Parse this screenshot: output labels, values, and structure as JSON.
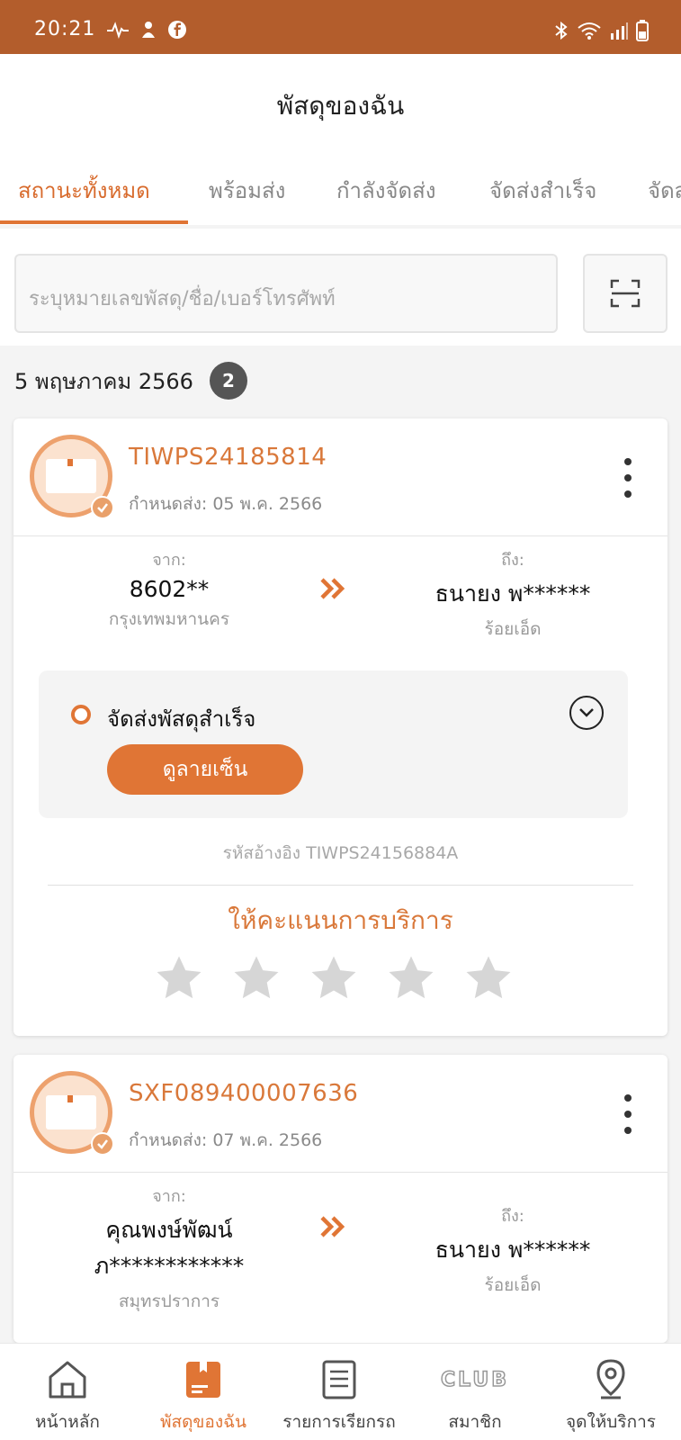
{
  "status_bar": {
    "time": "20:21",
    "left_icons": [
      "activity-icon",
      "baby-icon",
      "facebook-icon"
    ],
    "right_icons": [
      "bluetooth-icon",
      "wifi-icon",
      "signal-icon",
      "battery-icon"
    ]
  },
  "header": {
    "title": "พัสดุของฉัน"
  },
  "tabs": [
    {
      "label": "สถานะทั้งหมด",
      "active": true
    },
    {
      "label": "พร้อมส่ง"
    },
    {
      "label": "กำลังจัดส่ง"
    },
    {
      "label": "จัดส่งสำเร็จ"
    },
    {
      "label": "จัดส"
    }
  ],
  "search": {
    "placeholder": "ระบุหมายเลขพัสดุ/ชื่อ/เบอร์โทรศัพท์"
  },
  "date_group": {
    "date": "5 พฤษภาคม 2566",
    "count": "2"
  },
  "parcels": [
    {
      "tracking": "TIWPS24185814",
      "due": "กำหนดส่ง: 05 พ.ค. 2566",
      "from_label": "จาก:",
      "from_name": "8602**",
      "from_area": "กรุงเทพมหานคร",
      "to_label": "ถึง:",
      "to_name": "ธนายง พ******",
      "to_area": "ร้อยเอ็ด",
      "status": "จัดส่งพัสดุสำเร็จ",
      "signature_button": "ดูลายเซ็น",
      "reference": "รหัสอ้างอิง TIWPS24156884A",
      "rating_title": "ให้คะแนนการบริการ",
      "rating": 0
    },
    {
      "tracking": "SXF089400007636",
      "due": "กำหนดส่ง: 07 พ.ค. 2566",
      "from_label": "จาก:",
      "from_name_line1": "คุณพงษ์พัฒน์",
      "from_name_line2": "ภ************",
      "from_area": "สมุทรปราการ",
      "to_label": "ถึง:",
      "to_name": "ธนายง พ******",
      "to_area": "ร้อยเอ็ด"
    }
  ],
  "bottom_nav": [
    {
      "label": "หน้าหลัก",
      "icon": "home-icon"
    },
    {
      "label": "พัสดุของฉัน",
      "icon": "parcel-icon",
      "active": true
    },
    {
      "label": "รายการเรียกรถ",
      "icon": "list-icon"
    },
    {
      "label": "สมาชิก",
      "icon": "club-icon",
      "icon_text": "CLUB"
    },
    {
      "label": "จุดให้บริการ",
      "icon": "location-pin-icon"
    }
  ],
  "colors": {
    "brand": "#e07535",
    "status_bar": "#b35d2c",
    "star_empty": "#d6d6d6"
  }
}
